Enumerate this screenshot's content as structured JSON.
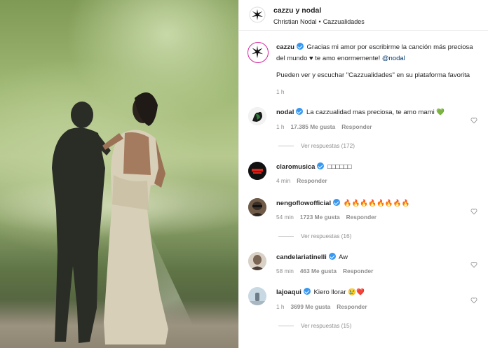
{
  "post": {
    "title": "cazzu y nodal",
    "subtitle_left": "Christian Nodal",
    "subtitle_sep": "•",
    "subtitle_right": "Cazzualidades"
  },
  "caption": {
    "user": "cazzu",
    "line1": "Gracias mi amor por escribirme la canción más preciosa",
    "line2_a": "del mundo ♥ te amo enormemente!",
    "line2_mention": "@nodal",
    "line3": "Pueden ver y escuchar \"Cazzualidades\" en su plataforma favorita",
    "time": "1 h"
  },
  "comments": [
    {
      "user": "nodal",
      "text": "La cazzualidad mas preciosa, te amo mami 💚",
      "time": "1 h",
      "likes": "17.385 Me gusta",
      "reply": "Responder",
      "view_replies": "Ver respuestas (172)"
    },
    {
      "user": "claromusica",
      "text": "□□□□□□",
      "time": "4 min",
      "likes": "",
      "reply": "Responder",
      "view_replies": ""
    },
    {
      "user": "nengoflowofficial",
      "text": "🔥🔥🔥🔥🔥🔥🔥🔥",
      "time": "54 min",
      "likes": "1723 Me gusta",
      "reply": "Responder",
      "view_replies": "Ver respuestas (16)"
    },
    {
      "user": "candelariatinelli",
      "text": "Aw",
      "time": "58 min",
      "likes": "463 Me gusta",
      "reply": "Responder",
      "view_replies": ""
    },
    {
      "user": "lajoaqui",
      "text": "Kiero llorar 😢❤️",
      "time": "1 h",
      "likes": "3699 Me gusta",
      "reply": "Responder",
      "view_replies": "Ver respuestas (15)"
    }
  ],
  "colors": {
    "verified": "#3897f0",
    "meta": "#8e8e8e",
    "mention": "#00376b"
  }
}
